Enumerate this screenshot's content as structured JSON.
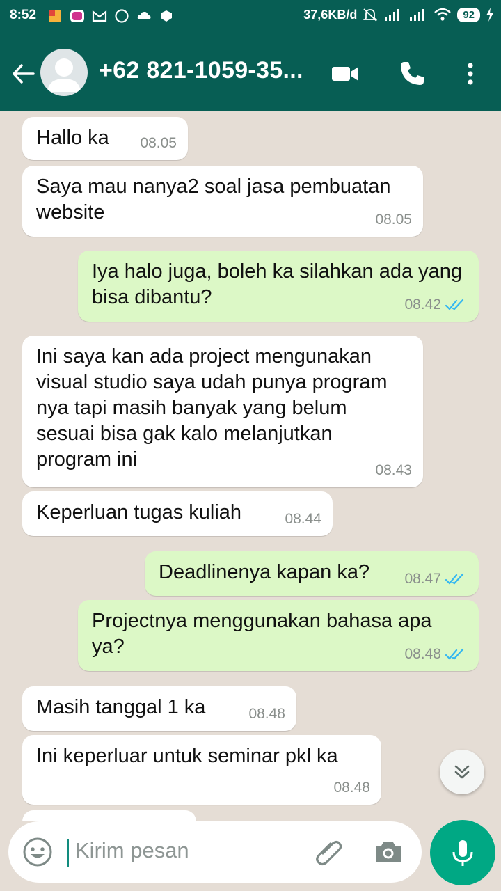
{
  "status_bar": {
    "time": "8:52",
    "speed": "37,6KB/d",
    "battery": "92"
  },
  "header": {
    "contact": "+62 821-1059-35..."
  },
  "composer": {
    "placeholder": "Kirim pesan"
  },
  "messages": [
    {
      "dir": "in",
      "text": "Hallo ka",
      "time": "08.05"
    },
    {
      "dir": "in",
      "text": "Saya mau nanya2 soal jasa pembuatan website",
      "time": "08.05"
    },
    {
      "dir": "out",
      "text": "Iya halo juga, boleh ka silahkan ada yang bisa dibantu?",
      "time": "08.42"
    },
    {
      "dir": "in",
      "text": "Ini saya kan ada project mengunakan visual studio saya udah punya program nya tapi masih banyak yang belum sesuai bisa gak kalo melanjutkan program ini",
      "time": "08.43"
    },
    {
      "dir": "in",
      "text": "Keperluan tugas kuliah",
      "time": "08.44"
    },
    {
      "dir": "out",
      "text": "Deadlinenya kapan ka?",
      "time": "08.47"
    },
    {
      "dir": "out",
      "text": "Projectnya menggunakan bahasa apa ya?",
      "time": "08.48"
    },
    {
      "dir": "in",
      "text": "Masih tanggal 1 ka",
      "time": "08.48"
    },
    {
      "dir": "in",
      "text": "Ini keperluar untuk seminar pkl ka",
      "time": "08.48"
    }
  ],
  "colors": {
    "header": "#075e54",
    "outgoing": "#dcf8c6",
    "incoming": "#ffffff",
    "accent": "#00a884",
    "read_ticks": "#34b7f1"
  },
  "icons": [
    "back-arrow-icon",
    "video-call-icon",
    "phone-icon",
    "more-vert-icon",
    "emoji-icon",
    "attach-icon",
    "camera-icon",
    "mic-icon",
    "scroll-down-icon"
  ]
}
